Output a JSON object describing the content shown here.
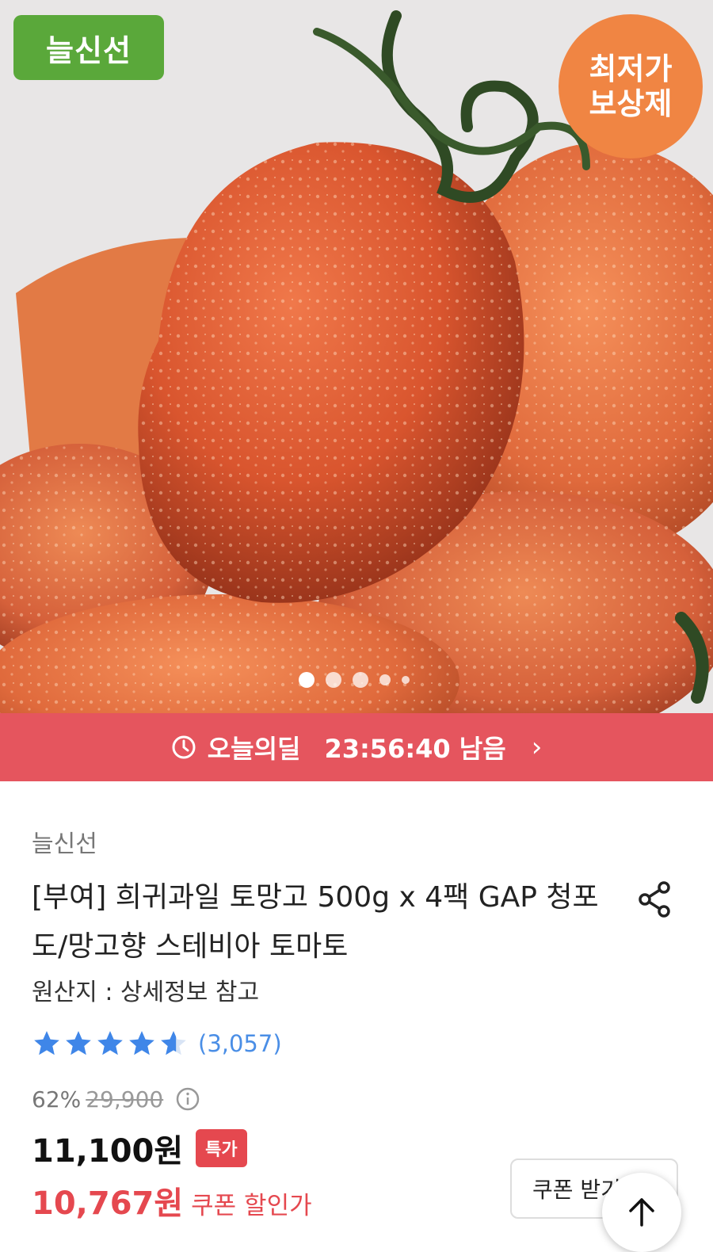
{
  "badges": {
    "brand": "늘신선",
    "price_guarantee_line1": "최저가",
    "price_guarantee_line2": "보상제"
  },
  "carousel": {
    "total": 5,
    "active_index": 0
  },
  "deal": {
    "label": "오늘의딜",
    "time_remaining": "23:56:40 남음",
    "chevron": "›"
  },
  "product": {
    "seller": "늘신선",
    "title": "[부여] 희귀과일 토망고 500g x 4팩 GAP 청포도/망고향 스테비아 토마토",
    "origin": "원산지 : 상세정보 참고",
    "rating": 4.5,
    "review_count": "(3,057)",
    "discount_percent": "62%",
    "original_price": "29,900",
    "sale_price": "11,100원",
    "special_tag": "특가",
    "coupon_price": "10,767원",
    "coupon_label": "쿠폰 할인가"
  },
  "buttons": {
    "coupon": "쿠폰 받기"
  },
  "colors": {
    "brand_green": "#5aa83a",
    "badge_orange": "#f08543",
    "deal_red": "#e5555e",
    "star_blue": "#3f86e8",
    "price_red": "#e5484f"
  },
  "icons": [
    "clock-icon",
    "chevron-right-icon",
    "share-icon",
    "star-icon",
    "info-icon",
    "arrow-up-icon"
  ]
}
